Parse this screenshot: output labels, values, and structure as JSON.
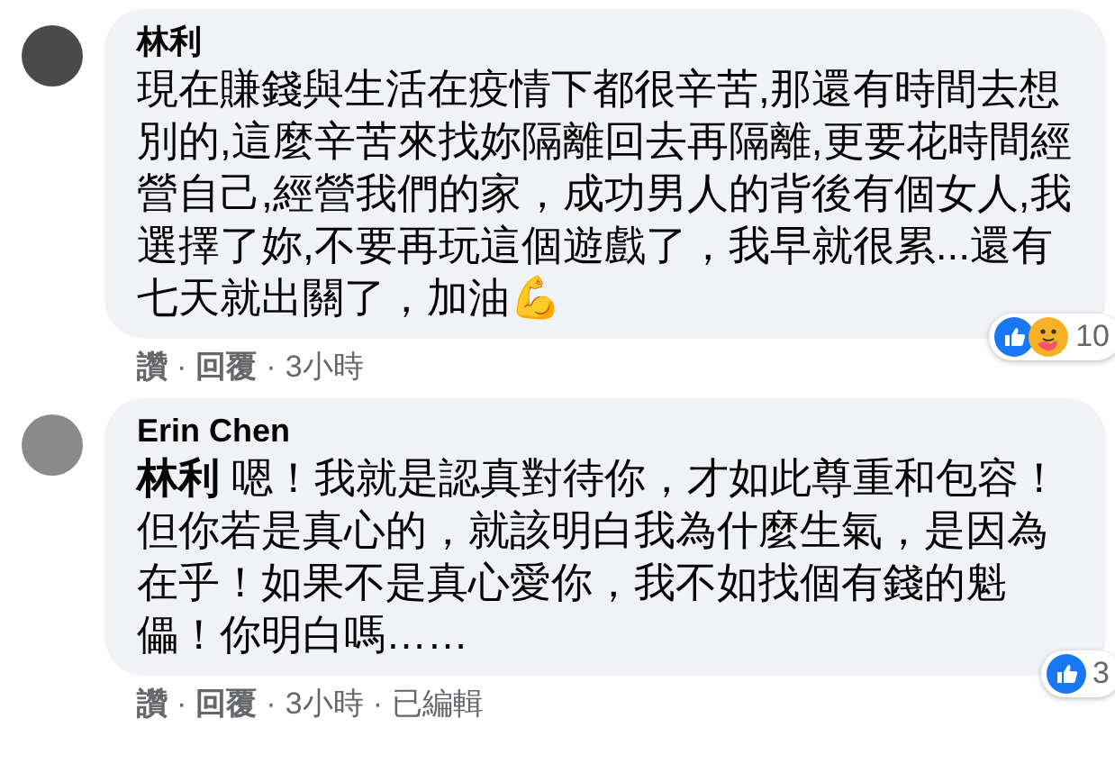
{
  "separator": "·",
  "comments": [
    {
      "author": "林利",
      "text": "現在賺錢與生活在疫情下都很辛苦,那還有時間去想別的,這麼辛苦來找妳隔離回去再隔離,更要花時間經營自己,經營我們的家，成功男人的背後有個女人,我選擇了妳,不要再玩這個遊戲了，我早就很累...還有七天就出關了，加油💪",
      "reactions": [
        {
          "kind": "like"
        },
        {
          "kind": "care"
        }
      ],
      "reaction_count": "10",
      "actions": [
        "讚",
        "回覆",
        "3小時"
      ]
    },
    {
      "author": "Erin Chen",
      "text": "**林利** 嗯！我就是認真對待你，才如此尊重和包容！但你若是真心的，就該明白我為什麼生氣，是因為在乎！如果不是真心愛你，我不如找個有錢的魁儡！你明白嗎……",
      "reactions": [
        {
          "kind": "like"
        }
      ],
      "reaction_count": "3",
      "actions": [
        "讚",
        "回覆",
        "3小時",
        "已編輯"
      ]
    }
  ]
}
